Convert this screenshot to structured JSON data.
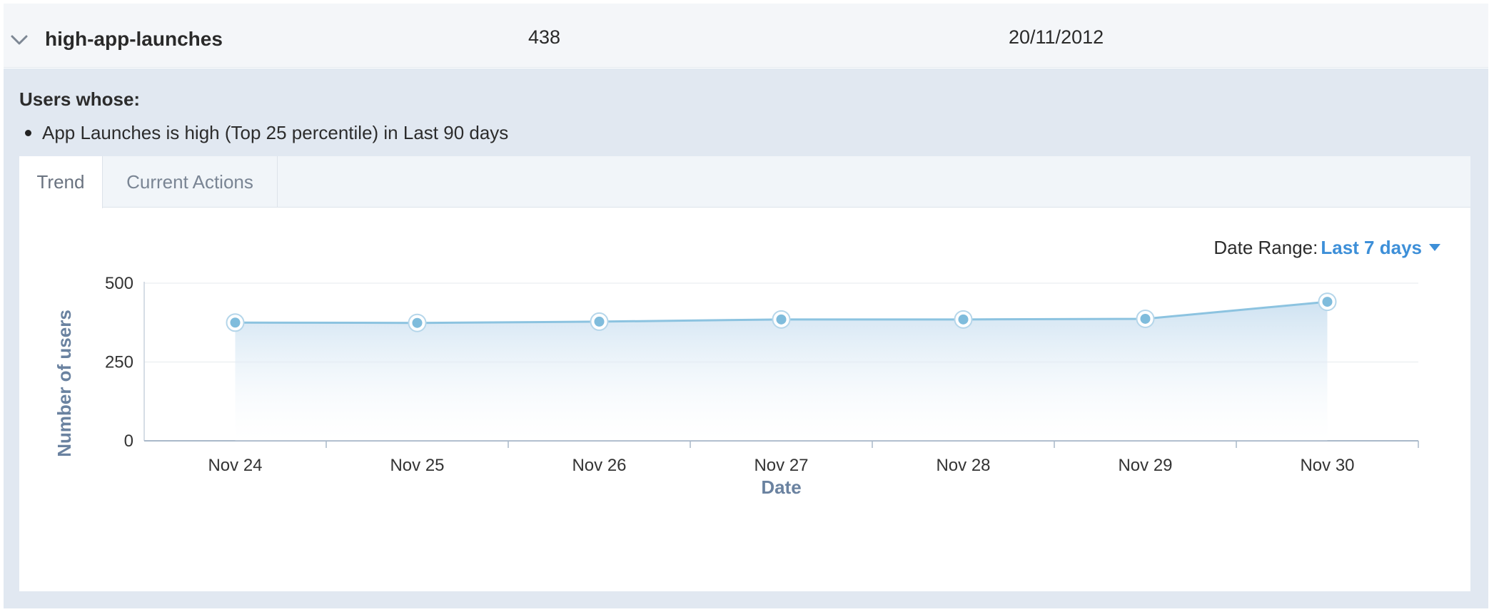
{
  "segment": {
    "name": "high-app-launches",
    "count": "438",
    "date": "20/11/2012"
  },
  "panel": {
    "heading": "Users whose:",
    "criteria": [
      "App Launches is high (Top 25 percentile) in Last 90 days"
    ]
  },
  "tabs": [
    {
      "label": "Trend",
      "active": true
    },
    {
      "label": "Current Actions",
      "active": false
    }
  ],
  "date_range": {
    "label": "Date Range:",
    "value": "Last 7 days"
  },
  "colors": {
    "line": "#8cc3e0",
    "marker": "#7fbcdc",
    "link": "#3d8fd8",
    "axis_title": "#6a82a0",
    "panel_bg": "#e1e8f1"
  },
  "icons": {
    "expand": "chevron-down-icon",
    "dropdown": "caret-down-icon"
  },
  "chart_data": {
    "type": "area",
    "categories": [
      "Nov 24",
      "Nov 25",
      "Nov 26",
      "Nov 27",
      "Nov 28",
      "Nov 29",
      "Nov 30"
    ],
    "series": [
      {
        "values": [
          375,
          374,
          378,
          385,
          385,
          387,
          441
        ]
      }
    ],
    "xlabel": "Date",
    "ylabel": "Number of users",
    "ylim": [
      0,
      500
    ],
    "yticks": [
      0,
      250,
      500
    ],
    "grid": true,
    "legend": "none"
  }
}
